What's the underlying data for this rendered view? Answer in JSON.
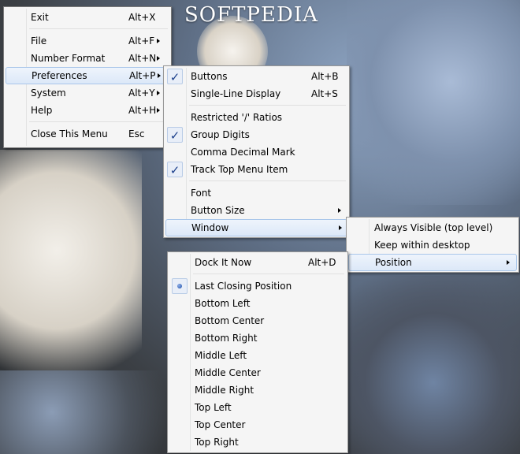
{
  "watermark": "SOFTPEDIA",
  "main_menu": {
    "exit": {
      "label": "Exit",
      "accel": "Alt+X"
    },
    "file": {
      "label": "File",
      "accel": "Alt+F"
    },
    "number_format": {
      "label": "Number Format",
      "accel": "Alt+N"
    },
    "preferences": {
      "label": "Preferences",
      "accel": "Alt+P"
    },
    "system": {
      "label": "System",
      "accel": "Alt+Y"
    },
    "help": {
      "label": "Help",
      "accel": "Alt+H"
    },
    "close": {
      "label": "Close This Menu",
      "accel": "Esc"
    }
  },
  "preferences_menu": {
    "buttons": {
      "label": "Buttons",
      "accel": "Alt+B",
      "checked": true
    },
    "single_line": {
      "label": "Single-Line Display",
      "accel": "Alt+S",
      "checked": false
    },
    "restricted": {
      "label": "Restricted '/' Ratios",
      "checked": false
    },
    "group_digits": {
      "label": "Group Digits",
      "checked": true
    },
    "comma_decimal": {
      "label": "Comma Decimal Mark",
      "checked": false
    },
    "track_top": {
      "label": "Track Top Menu Item",
      "checked": true
    },
    "font": {
      "label": "Font"
    },
    "button_size": {
      "label": "Button Size"
    },
    "window": {
      "label": "Window"
    }
  },
  "window_menu": {
    "always_visible": {
      "label": "Always Visible (top level)"
    },
    "keep_within": {
      "label": "Keep within desktop"
    },
    "position": {
      "label": "Position"
    }
  },
  "position_menu": {
    "dock": {
      "label": "Dock It Now",
      "accel": "Alt+D"
    },
    "items": [
      {
        "label": "Last Closing Position",
        "selected": true
      },
      {
        "label": "Bottom Left"
      },
      {
        "label": "Bottom Center"
      },
      {
        "label": "Bottom Right"
      },
      {
        "label": "Middle Left"
      },
      {
        "label": "Middle Center"
      },
      {
        "label": "Middle Right"
      },
      {
        "label": "Top Left"
      },
      {
        "label": "Top Center"
      },
      {
        "label": "Top Right"
      }
    ]
  },
  "icons": {
    "check": "✓",
    "submenu_arrow": "triangle-right",
    "radio_bullet": "bullet"
  },
  "colors": {
    "highlight_border": "#a9c6ea",
    "check": "#1b3f8b",
    "menu_bg": "#f5f5f5"
  }
}
